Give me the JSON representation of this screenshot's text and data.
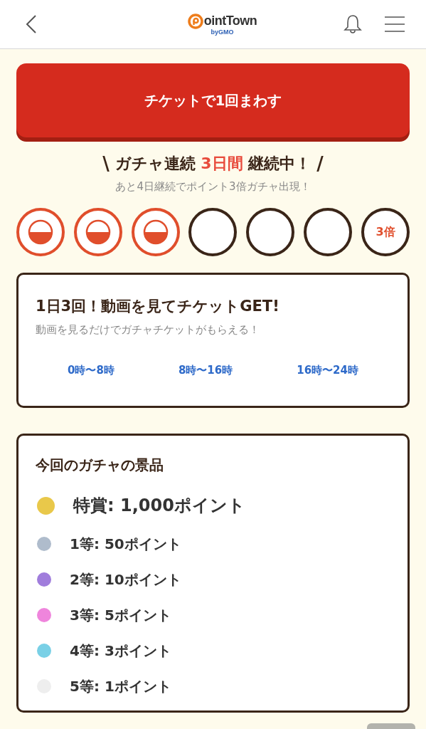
{
  "header": {
    "logo_text": "ointTown",
    "logo_sub": "byGMO"
  },
  "spin_button": {
    "label": "チケットで1回まわす"
  },
  "streak": {
    "deco_left": "\\",
    "prefix": "ガチャ連続 ",
    "highlight": "3日間",
    "suffix": " 継続中！",
    "deco_right": "/",
    "note": "あと4日継続でポイント3倍ガチャ出現！",
    "days": [
      {
        "stamped": true
      },
      {
        "stamped": true
      },
      {
        "stamped": true
      },
      {
        "stamped": false
      },
      {
        "stamped": false
      },
      {
        "stamped": false
      },
      {
        "stamped": false,
        "label": "3倍"
      }
    ]
  },
  "video_card": {
    "title": "1日3回！動画を見てチケットGET!",
    "subtitle": "動画を見るだけでガチャチケットがもらえる！",
    "slots": [
      "0時〜8時",
      "8時〜16時",
      "16時〜24時"
    ]
  },
  "prizes": {
    "title": "今回のガチャの景品",
    "items": [
      {
        "kind": "grand",
        "label": "特賞: 1,000ポイント",
        "color": "#e9c84a"
      },
      {
        "kind": "normal",
        "label": "1等: 50ポイント",
        "color": "#afbccc"
      },
      {
        "kind": "normal",
        "label": "2等: 10ポイント",
        "color": "#a07ddc"
      },
      {
        "kind": "normal",
        "label": "3等: 5ポイント",
        "color": "#ef85dc"
      },
      {
        "kind": "normal",
        "label": "4等: 3ポイント",
        "color": "#79d0e6"
      },
      {
        "kind": "normal",
        "label": "5等: 1ポイント",
        "color": "#eeeeee"
      }
    ]
  }
}
